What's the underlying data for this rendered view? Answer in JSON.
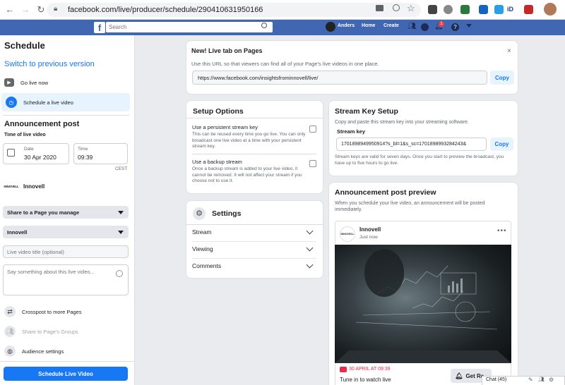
{
  "browser": {
    "url": "facebook.com/live/producer/schedule/290410631950166"
  },
  "fbbar": {
    "search_placeholder": "Search",
    "user": "Anders",
    "home": "Home",
    "create": "Create",
    "notif_count": "1"
  },
  "sidebar": {
    "title": "Schedule",
    "switch_link": "Switch to previous version",
    "go_live": "Go live now",
    "schedule_live": "Schedule a live video",
    "announce_title": "Announcement post",
    "time_label": "Time of live video",
    "date_label": "Date",
    "date_value": "30 Apr 2020",
    "time_field_label": "Time",
    "time_value": "09:39",
    "timezone": "CEST",
    "page_name": "Innovell",
    "logo_text": "INNOVELL",
    "share_dropdown": "Share to a Page you manage",
    "page_dropdown": "Innovell",
    "title_placeholder": "Live video title (optional)",
    "desc_placeholder": "Say something about this live video...",
    "crosspost": "Crosspost to more Pages",
    "share_groups": "Share to Page's Groups",
    "audience": "Audience settings",
    "schedule_button": "Schedule Live Video"
  },
  "live_tab": {
    "title": "New! Live tab on Pages",
    "desc": "Use this URL so that viewers can find all of your Page's live videos in one place.",
    "url": "https://www.facebook.com/insightsfrominnovell/live/",
    "copy": "Copy"
  },
  "setup": {
    "title": "Setup Options",
    "opt1_title": "Use a persistent stream key",
    "opt1_desc": "This can be reused every time you go live. You can only broadcast one live video at a time with your persistent stream key.",
    "opt2_title": "Use a backup stream",
    "opt2_desc": "Once a backup stream is added to your live video, it cannot be removed. It will not affect your stream if you choose not to use it."
  },
  "settings": {
    "title": "Settings",
    "stream": "Stream",
    "viewing": "Viewing",
    "comments": "Comments"
  },
  "stream_key": {
    "title": "Stream Key Setup",
    "desc": "Copy and paste this stream key into your streaming software.",
    "label": "Stream key",
    "value": "1701898949950914?s_bl=1&s_sc=1701898993284243&",
    "copy": "Copy",
    "note": "Stream keys are valid for seven days. Once you start to preview the broadcast, you have up to five hours to go live."
  },
  "preview": {
    "title": "Announcement post preview",
    "desc": "When you schedule your live video, an announcement will be posted immediately.",
    "page_name": "Innovell",
    "time": "Just now",
    "live_date": "30 APRIL AT 09:39",
    "tune_in": "Tune in to watch live",
    "get_reminder": "Get Re"
  },
  "chat": {
    "label": "Chat (45)"
  }
}
